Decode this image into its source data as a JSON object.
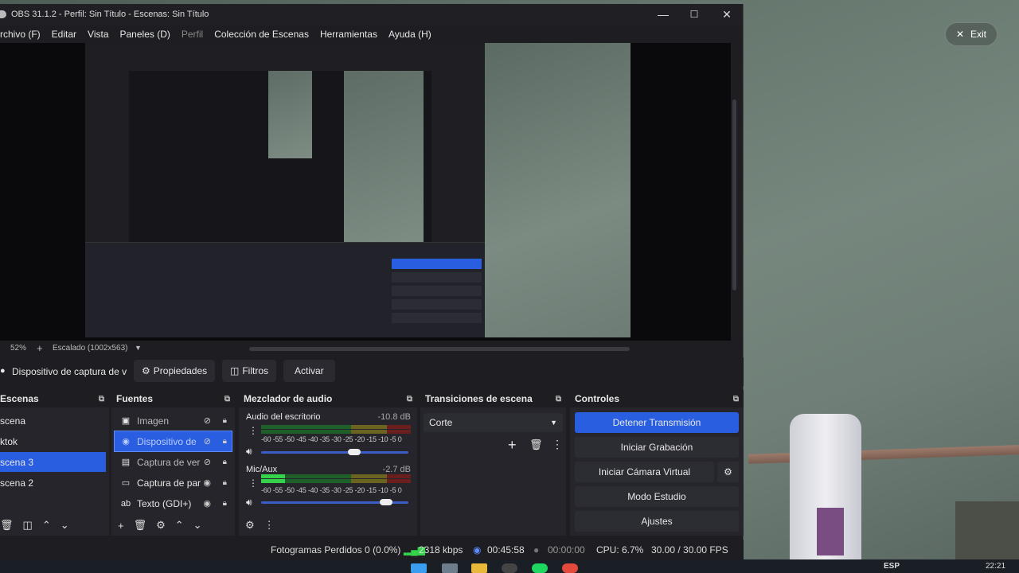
{
  "window": {
    "title": "OBS 31.1.2 - Perfil: Sin Título - Escenas: Sin Título",
    "minimize": "—",
    "maximize": "☐",
    "close": "✕"
  },
  "menu": [
    "rchivo (F)",
    "Editar",
    "Vista",
    "Paneles (D)",
    "Perfil",
    "Colección de Escenas",
    "Herramientas",
    "Ayuda (H)"
  ],
  "preview": {
    "zoom": "52%",
    "scaling": "Escalado (1002x563)"
  },
  "source_toolbar": {
    "current_source": "Dispositivo de captura de v",
    "properties": "Propiedades",
    "filters": "Filtros",
    "activate": "Activar"
  },
  "scenes": {
    "title": "Escenas",
    "items": [
      "scena",
      "ktok",
      "scena 3",
      "scena 2"
    ],
    "selected": 2
  },
  "sources": {
    "title": "Fuentes",
    "items": [
      {
        "icon": "image-icon",
        "label": "Imagen",
        "visible": false
      },
      {
        "icon": "camera-icon",
        "label": "Dispositivo de",
        "visible": false
      },
      {
        "icon": "window-icon",
        "label": "Captura de ver",
        "visible": false
      },
      {
        "icon": "monitor-icon",
        "label": "Captura de par",
        "visible": true
      },
      {
        "icon": "text-icon",
        "label": "Texto (GDI+)",
        "visible": true
      }
    ]
  },
  "mixer": {
    "title": "Mezclador de audio",
    "ticks": "-60 -55 -50 -45 -40 -35 -30 -25 -20 -15 -10 -5  0",
    "channels": [
      {
        "name": "Audio del escritorio",
        "db": "-10.8 dB",
        "level": 0.0,
        "volume": 0.62
      },
      {
        "name": "Mic/Aux",
        "db": "-2.7 dB",
        "level": 0.16,
        "volume": 0.85
      }
    ]
  },
  "transitions": {
    "title": "Transiciones de escena",
    "selected": "Corte"
  },
  "controls": {
    "title": "Controles",
    "stop_stream": "Detener Transmisión",
    "start_recording": "Iniciar Grabación",
    "virtual_cam": "Iniciar Cámara Virtual",
    "studio_mode": "Modo Estudio",
    "settings": "Ajustes"
  },
  "status": {
    "dropped": "Fotogramas Perdidos 0 (0.0%)",
    "bitrate": "2318 kbps",
    "stream_time": "00:45:58",
    "rec_time": "00:00:00",
    "cpu": "CPU: 6.7%",
    "fps": "30.00 / 30.00 FPS"
  },
  "overlay": {
    "exit": "Exit"
  },
  "taskbar": {
    "lang": "ESP",
    "time": "22:21"
  }
}
